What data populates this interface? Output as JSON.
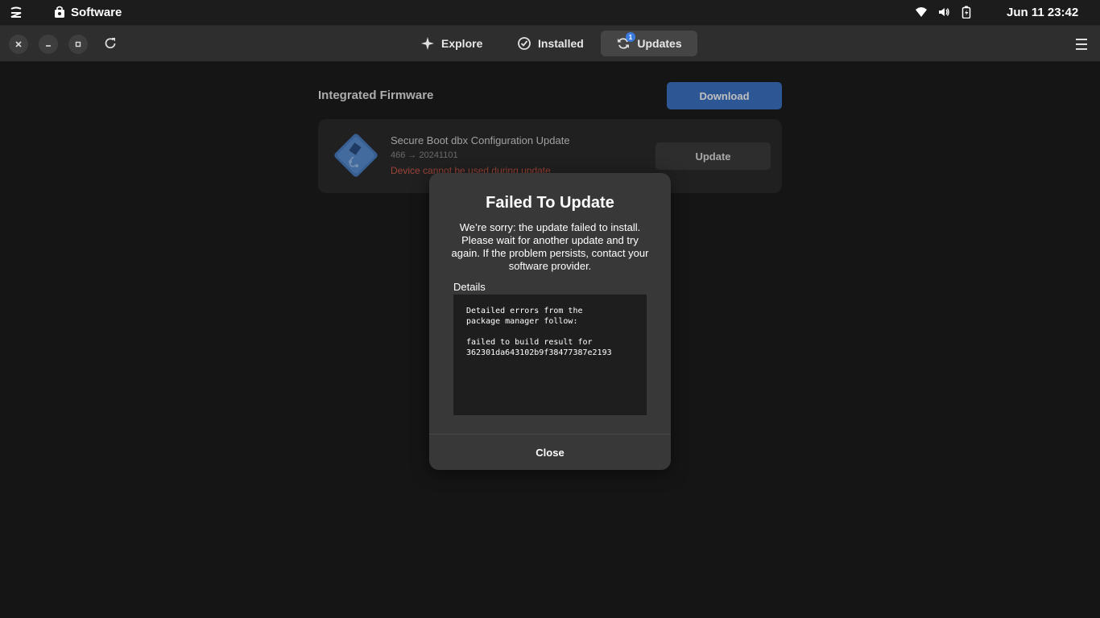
{
  "system_bar": {
    "app_name": "Software",
    "clock": "Jun 11  23:42",
    "icons": [
      "distro-logo-icon",
      "software-bag-icon",
      "wifi-icon",
      "volume-icon",
      "battery-icon"
    ]
  },
  "header": {
    "tabs": [
      {
        "label": "Explore",
        "icon": "star-icon"
      },
      {
        "label": "Installed",
        "icon": "check-circle-icon"
      },
      {
        "label": "Updates",
        "icon": "refresh-icon",
        "badge": "1",
        "active": true
      }
    ],
    "icons": [
      "close-icon",
      "minimize-icon",
      "maximize-icon",
      "refresh-icon",
      "hamburger-menu-icon"
    ]
  },
  "content": {
    "section_title": "Integrated Firmware",
    "download_label": "Download",
    "firmware": {
      "name": "Secure Boot dbx Configuration Update",
      "version": "466 → 20241101",
      "warning": "Device cannot be used during update",
      "update_label": "Update",
      "icon": "chip-icon"
    }
  },
  "dialog": {
    "title": "Failed To Update",
    "body": "We’re sorry: the update failed to install. Please wait for another update and try again. If the problem persists, contact your software provider.",
    "details_label": "Details",
    "details_text": "Detailed errors from the\npackage manager follow:\n\nfailed to build result for\n362301da643102b9f38477387e2193",
    "close_label": "Close"
  },
  "colors": {
    "accent": "#3d74c6",
    "warning": "#d05a4a",
    "background": "#1c1c1c",
    "card": "#2b2b2b",
    "dialog": "#383838"
  }
}
